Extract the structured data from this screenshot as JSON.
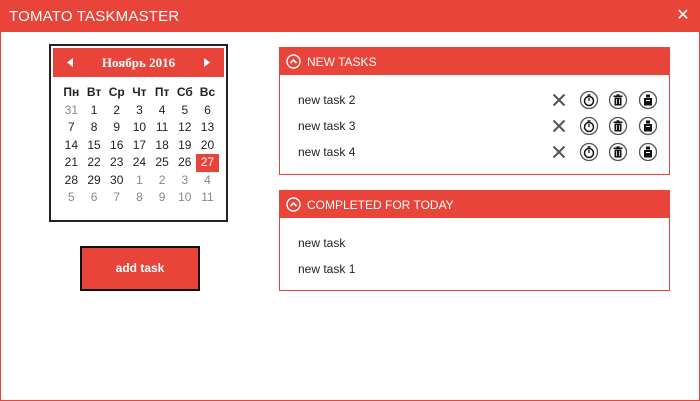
{
  "window": {
    "title": "TOMATO TASKMASTER",
    "accent_color": "#e8443a"
  },
  "calendar": {
    "month_label": "Ноябрь 2016",
    "weekdays": [
      "Пн",
      "Вт",
      "Ср",
      "Чт",
      "Пт",
      "Сб",
      "Вс"
    ],
    "weeks": [
      [
        {
          "d": "31",
          "o": true
        },
        {
          "d": "1"
        },
        {
          "d": "2"
        },
        {
          "d": "3"
        },
        {
          "d": "4"
        },
        {
          "d": "5"
        },
        {
          "d": "6"
        }
      ],
      [
        {
          "d": "7"
        },
        {
          "d": "8"
        },
        {
          "d": "9"
        },
        {
          "d": "10"
        },
        {
          "d": "11"
        },
        {
          "d": "12"
        },
        {
          "d": "13"
        }
      ],
      [
        {
          "d": "14"
        },
        {
          "d": "15"
        },
        {
          "d": "16"
        },
        {
          "d": "17"
        },
        {
          "d": "18"
        },
        {
          "d": "19"
        },
        {
          "d": "20"
        }
      ],
      [
        {
          "d": "21"
        },
        {
          "d": "22"
        },
        {
          "d": "23"
        },
        {
          "d": "24"
        },
        {
          "d": "25"
        },
        {
          "d": "26"
        },
        {
          "d": "27",
          "s": true
        }
      ],
      [
        {
          "d": "28"
        },
        {
          "d": "29"
        },
        {
          "d": "30"
        },
        {
          "d": "1",
          "o": true
        },
        {
          "d": "2",
          "o": true
        },
        {
          "d": "3",
          "o": true
        },
        {
          "d": "4",
          "o": true
        }
      ],
      [
        {
          "d": "5",
          "o": true
        },
        {
          "d": "6",
          "o": true
        },
        {
          "d": "7",
          "o": true
        },
        {
          "d": "8",
          "o": true
        },
        {
          "d": "9",
          "o": true
        },
        {
          "d": "10",
          "o": true
        },
        {
          "d": "11",
          "o": true
        }
      ]
    ],
    "selected_day": "27"
  },
  "add_button_label": "add task",
  "new_tasks": {
    "header": "NEW TASKS",
    "items": [
      {
        "label": "new task 2"
      },
      {
        "label": "new task 3"
      },
      {
        "label": "new task 4"
      }
    ],
    "action_icons": [
      "close-icon",
      "timer-icon",
      "trash-icon",
      "archive-icon"
    ]
  },
  "completed": {
    "header": "COMPLETED FOR TODAY",
    "items": [
      {
        "label": "new task"
      },
      {
        "label": "new task 1"
      }
    ]
  }
}
